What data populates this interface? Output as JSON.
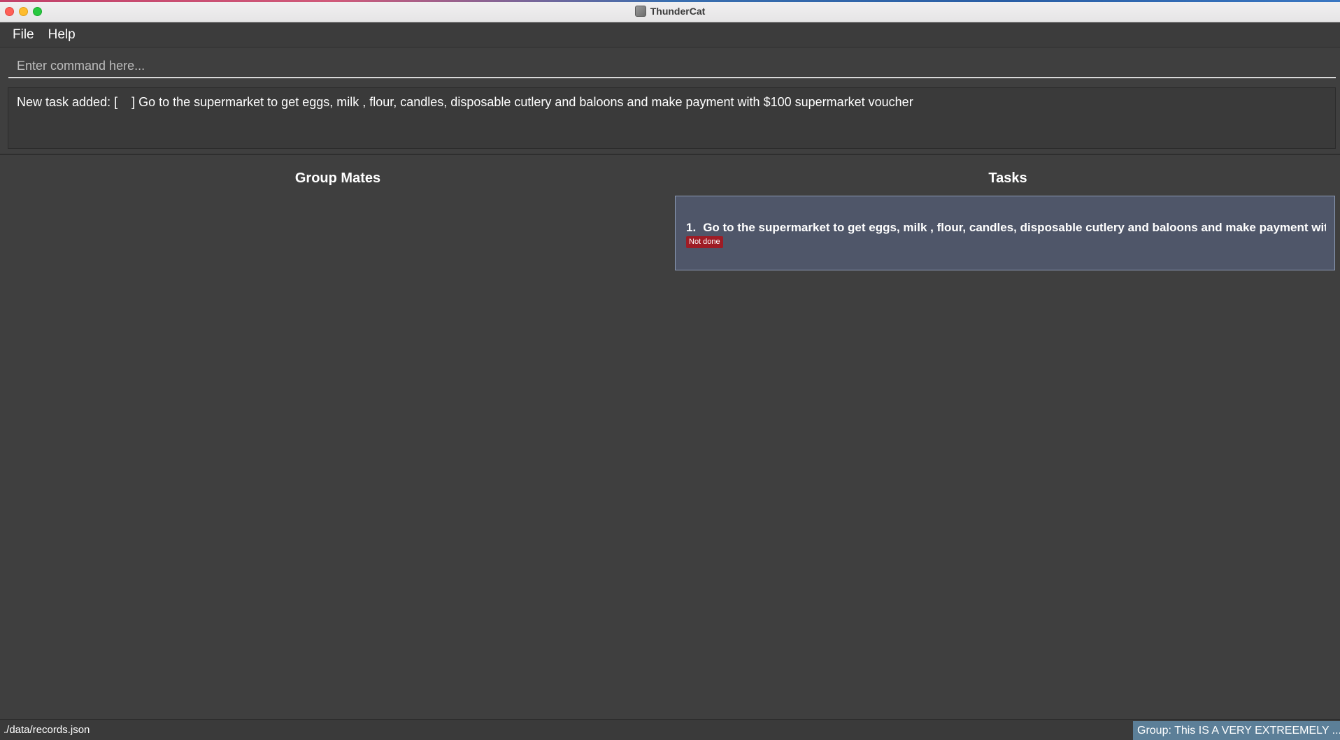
{
  "window": {
    "title": "ThunderCat",
    "icon": "app-icon"
  },
  "menu": {
    "items": [
      {
        "label": "File"
      },
      {
        "label": "Help"
      }
    ]
  },
  "command": {
    "placeholder": "Enter command here...",
    "value": ""
  },
  "result": {
    "text": "New task added: [    ] Go to the supermarket to get eggs, milk , flour, candles, disposable cutlery and baloons and make payment with $100 supermarket voucher"
  },
  "panels": {
    "group_mates_title": "Group Mates",
    "tasks_title": "Tasks"
  },
  "tasks": [
    {
      "index": "1.",
      "title": "Go to the supermarket to get eggs, milk , flour, candles, disposable cutlery and baloons and make payment with $...",
      "status": "Not done"
    }
  ],
  "statusbar": {
    "path": "./data/records.json",
    "group": "Group: This IS A VERY EXTREEMELY ..."
  },
  "colors": {
    "background": "#3f3f3f",
    "task_card": "#4f5669",
    "status_not_done": "#9e1c25",
    "group_badge": "#5c7f98"
  }
}
